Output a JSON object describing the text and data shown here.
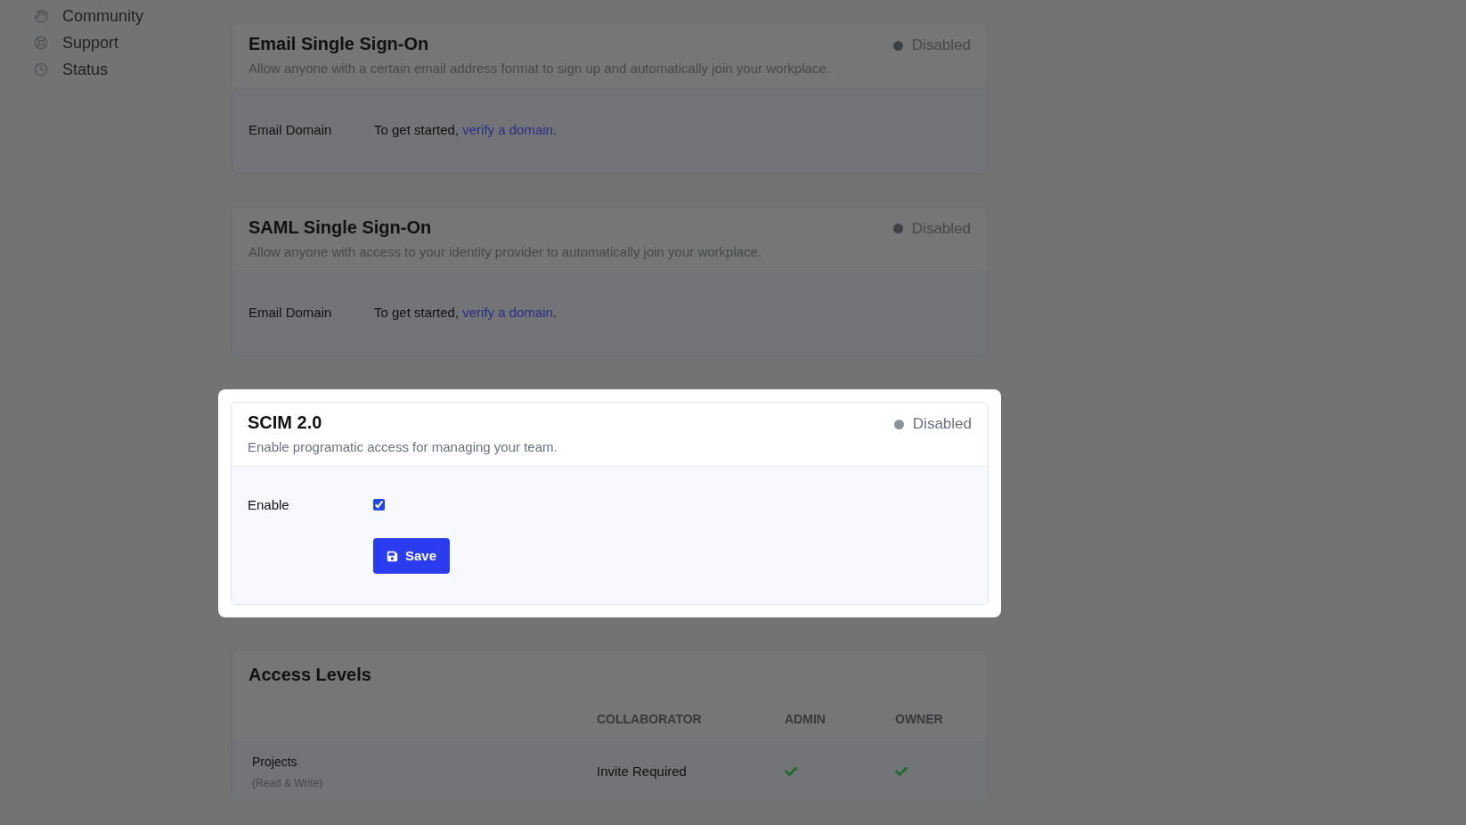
{
  "sidebar": {
    "items": [
      {
        "label": "Community"
      },
      {
        "label": "Support"
      },
      {
        "label": "Status"
      }
    ]
  },
  "sections": [
    {
      "kind": "domain",
      "title": "Email Single Sign-On",
      "description": "Allow anyone with a certain email address format to sign up and automatically join your workplace.",
      "status": "Disabled",
      "highlighted": false,
      "field_label": "Email Domain",
      "text": "To get started,",
      "link": "verify a domain",
      "after_link": "."
    },
    {
      "kind": "domain",
      "title": "SAML Single Sign-On",
      "description": "Allow anyone with access to your identity provider to automatically join your workplace.",
      "status": "Disabled",
      "highlighted": false,
      "field_label": "Email Domain",
      "text": "To get started,",
      "link": "verify a domain",
      "after_link": "."
    },
    {
      "kind": "enable",
      "title": "SCIM 2.0",
      "description": "Enable programatic access for managing your team.",
      "status": "Disabled",
      "highlighted": true,
      "field_label": "Enable",
      "checked": true,
      "button": "Save"
    }
  ],
  "access_levels": {
    "title": "Access Levels",
    "columns": [
      "COLLABORATOR",
      "ADMIN",
      "OWNER"
    ],
    "rows": [
      {
        "name": "Projects",
        "note": "(Read & Write)",
        "collaborator": "Invite Required",
        "admin": true,
        "owner": true
      }
    ]
  }
}
